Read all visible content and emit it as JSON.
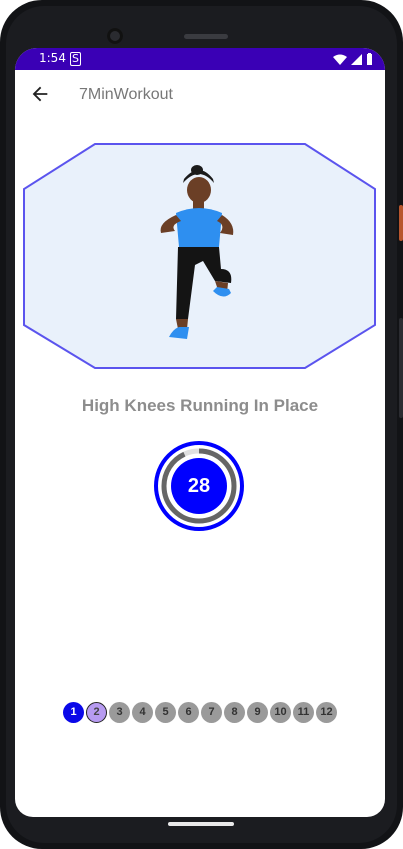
{
  "status_bar": {
    "time": "1:54",
    "indicator": "S",
    "icons": [
      "wifi-icon",
      "signal-icon",
      "battery-icon"
    ],
    "color": "#3a00b5"
  },
  "toolbar": {
    "title": "7MinWorkout",
    "back_icon": "arrow-back-icon"
  },
  "exercise": {
    "name": "High Knees Running In Place",
    "image": "high-knees-figure"
  },
  "timer": {
    "seconds_remaining": "28",
    "progress_fraction": 0.93,
    "colors": {
      "fill": "#0000ff",
      "track": "#666666"
    }
  },
  "steps": [
    {
      "label": "1",
      "state": "done"
    },
    {
      "label": "2",
      "state": "current"
    },
    {
      "label": "3",
      "state": "pending"
    },
    {
      "label": "4",
      "state": "pending"
    },
    {
      "label": "5",
      "state": "pending"
    },
    {
      "label": "6",
      "state": "pending"
    },
    {
      "label": "7",
      "state": "pending"
    },
    {
      "label": "8",
      "state": "pending"
    },
    {
      "label": "9",
      "state": "pending"
    },
    {
      "label": "10",
      "state": "pending"
    },
    {
      "label": "11",
      "state": "pending"
    },
    {
      "label": "12",
      "state": "pending"
    }
  ]
}
